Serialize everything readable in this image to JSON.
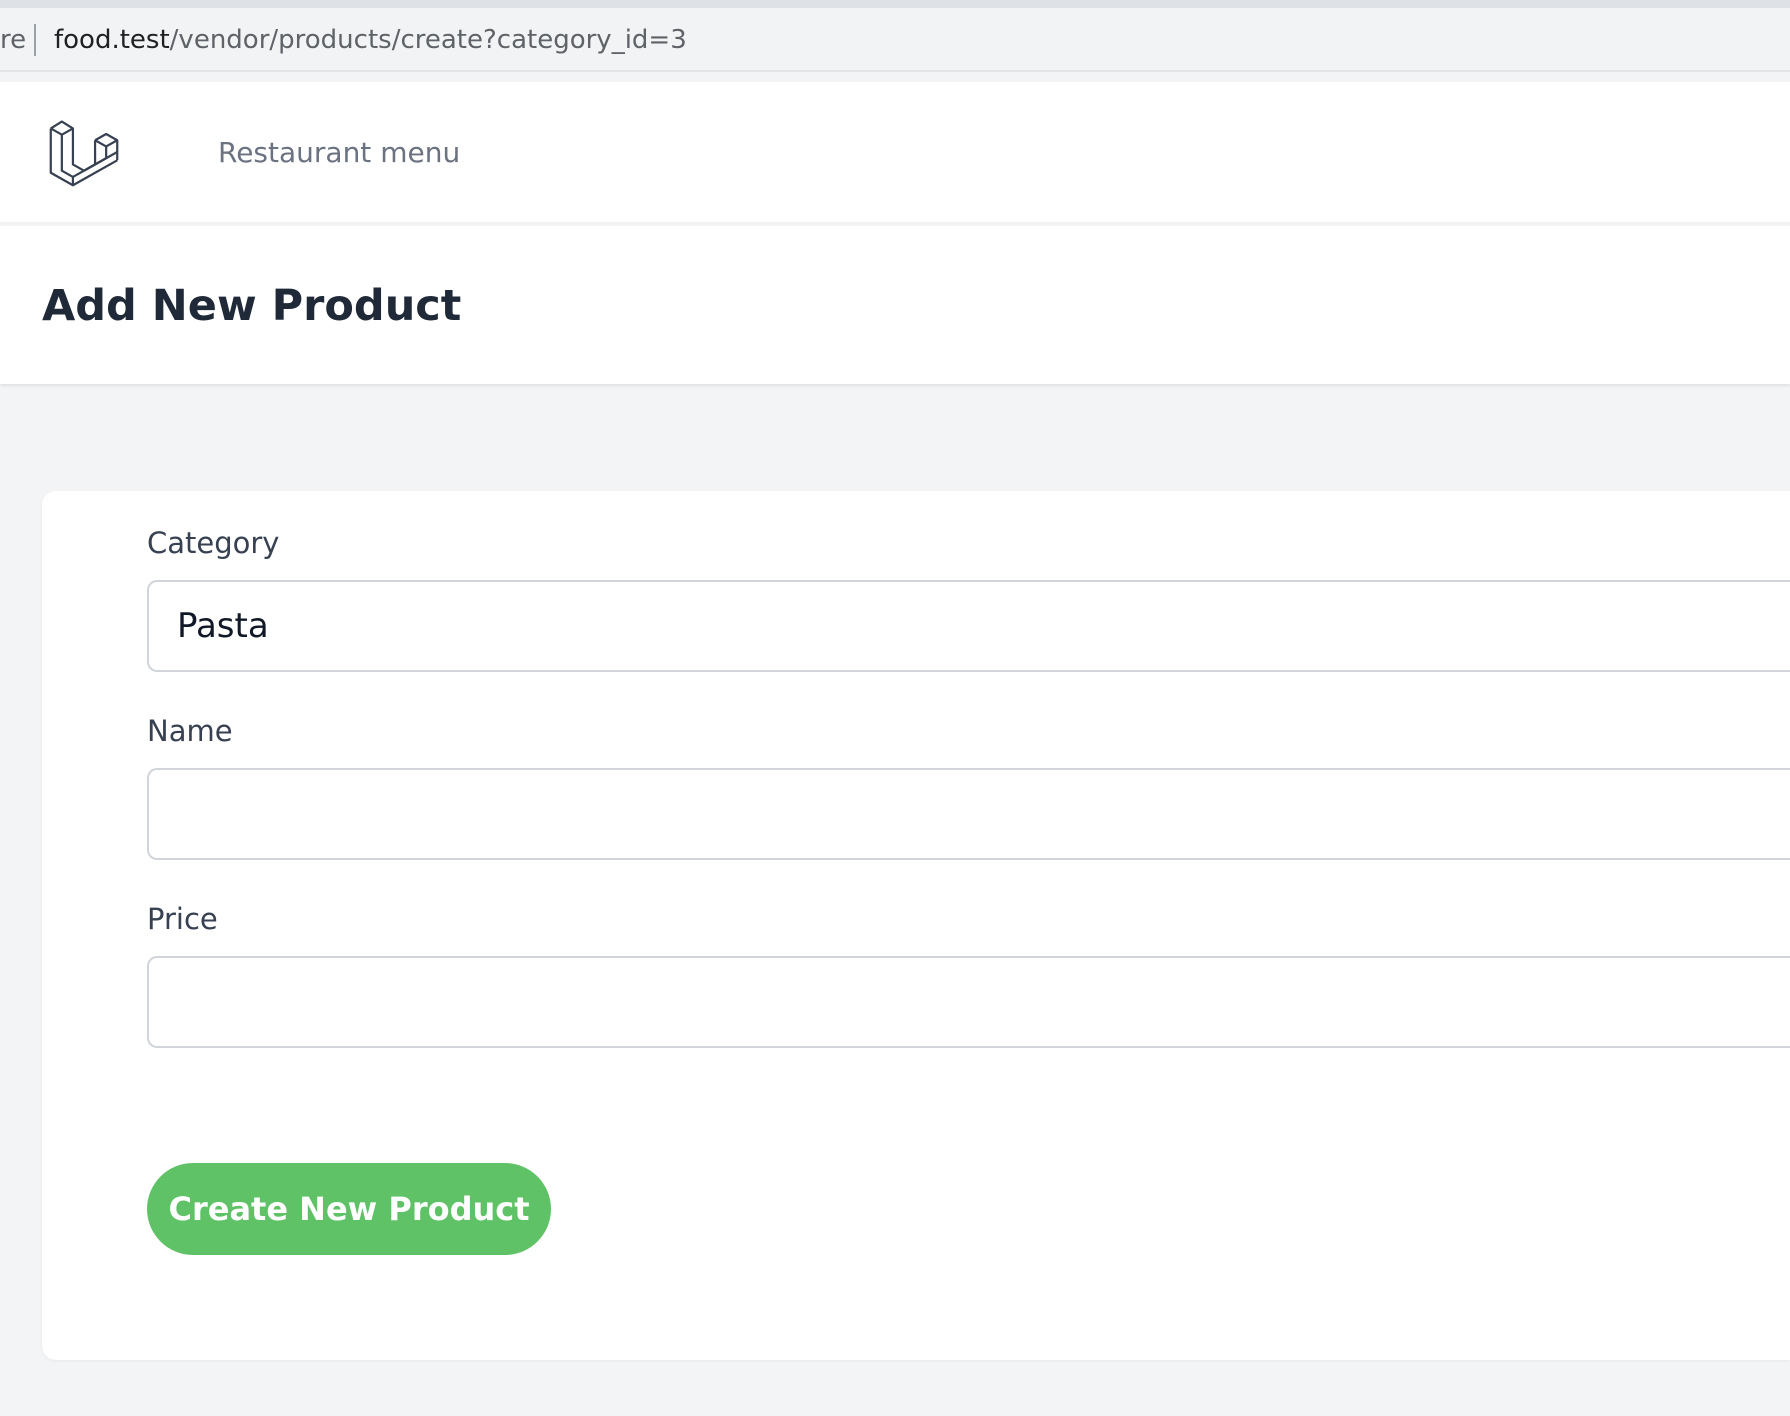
{
  "browser": {
    "url_prefix": "re",
    "url_host": "food.test",
    "url_path": "/vendor/products/create?category_id=3"
  },
  "nav": {
    "logo_icon": "laravel-logo-icon",
    "link_label": "Restaurant menu"
  },
  "header": {
    "title": "Add New Product"
  },
  "form": {
    "category": {
      "label": "Category",
      "value": "Pasta"
    },
    "name": {
      "label": "Name",
      "value": ""
    },
    "price": {
      "label": "Price",
      "value": ""
    },
    "submit_label": "Create New Product"
  },
  "colors": {
    "page_background": "#f3f4f6",
    "submit_button": "#5fc266",
    "title_text": "#1f2937"
  }
}
